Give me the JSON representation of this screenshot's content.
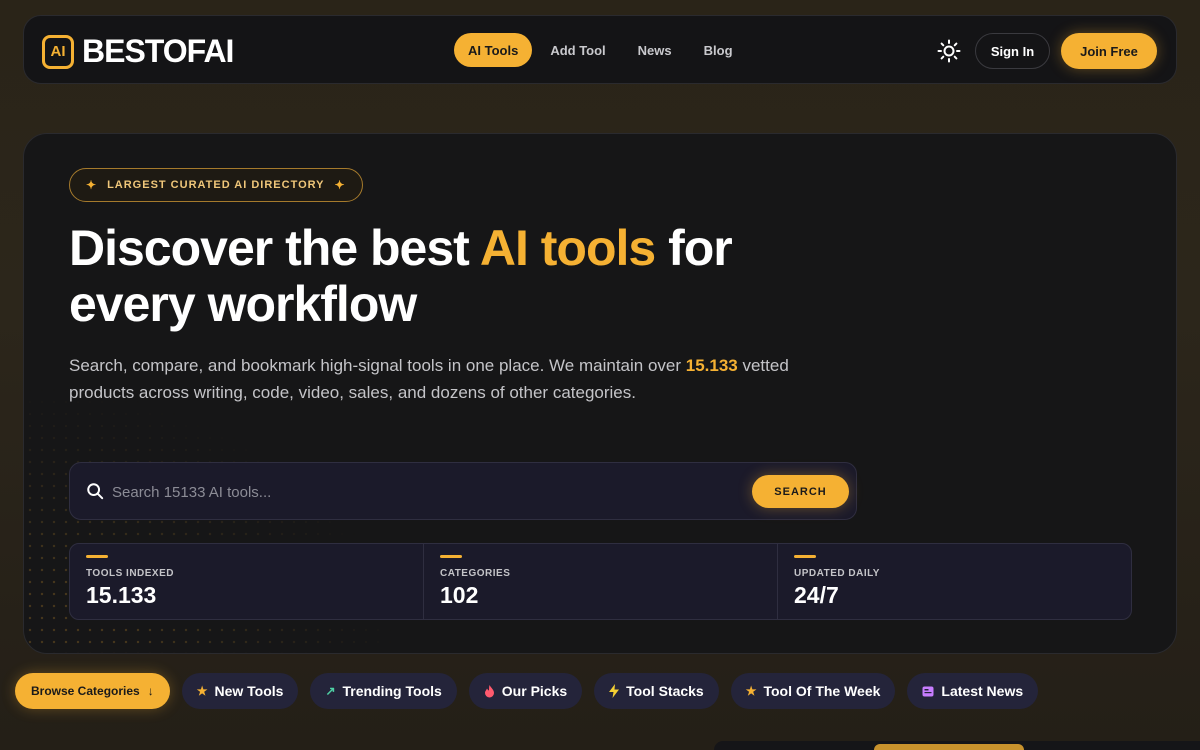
{
  "header": {
    "logo_badge": "AI",
    "logo_text": "BESTOFAI",
    "nav": [
      {
        "label": "AI Tools",
        "active": true
      },
      {
        "label": "Add Tool",
        "active": false
      },
      {
        "label": "News",
        "active": false
      },
      {
        "label": "Blog",
        "active": false
      }
    ],
    "theme_icon": "sun-icon",
    "sign_in": "Sign In",
    "join_free": "Join Free"
  },
  "hero": {
    "badge": "LARGEST CURATED AI DIRECTORY",
    "headline_pre": "Discover the best ",
    "headline_highlight": "AI tools",
    "headline_post": " for every workflow",
    "sub_pre": "Search, compare, and bookmark high-signal tools in one place. We maintain over ",
    "sub_count": "15.133",
    "sub_post": " vetted products across writing, code, video, sales, and dozens of other categories.",
    "search": {
      "placeholder": "Search 15133 AI tools...",
      "value": "",
      "button": "SEARCH"
    },
    "stats": [
      {
        "label": "TOOLS INDEXED",
        "value": "15.133"
      },
      {
        "label": "CATEGORIES",
        "value": "102"
      },
      {
        "label": "UPDATED DAILY",
        "value": "24/7"
      }
    ]
  },
  "chips": {
    "browse": "Browse Categories",
    "items": [
      {
        "label": "New Tools",
        "icon": "star-icon",
        "color": "#f5b133"
      },
      {
        "label": "Trending Tools",
        "icon": "trending-icon",
        "color": "#4fd1a5"
      },
      {
        "label": "Our Picks",
        "icon": "fire-icon",
        "color": "#ff5a6e"
      },
      {
        "label": "Tool Stacks",
        "icon": "bolt-icon",
        "color": "#f5d033"
      },
      {
        "label": "Tool Of The Week",
        "icon": "star-icon",
        "color": "#f5b133"
      },
      {
        "label": "Latest News",
        "icon": "news-icon",
        "color": "#c77dff"
      }
    ]
  },
  "colors": {
    "accent": "#f5b133",
    "panel": "#161617",
    "field": "#1b1a2a"
  }
}
